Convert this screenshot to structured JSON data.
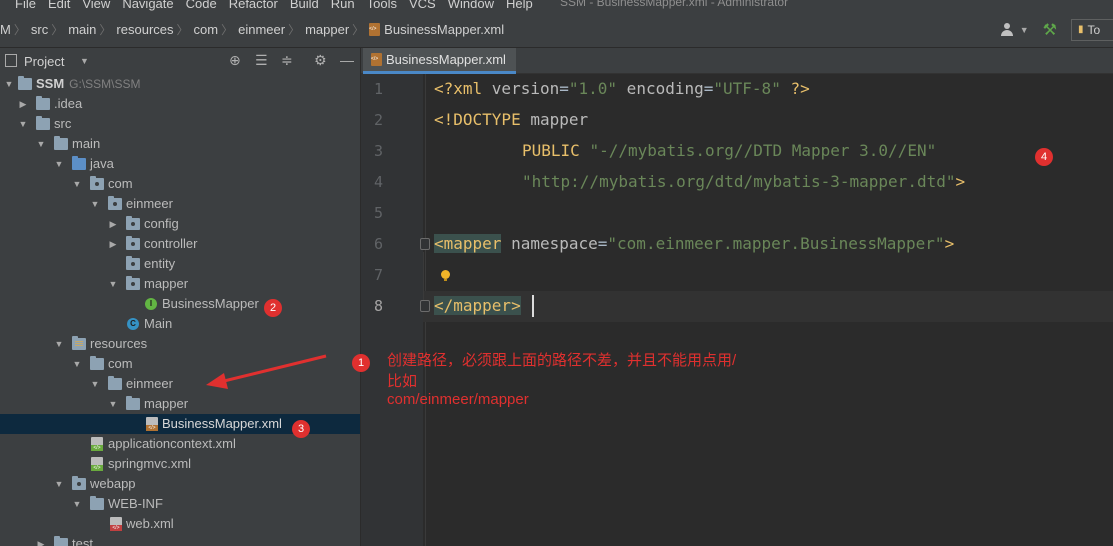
{
  "menu": [
    "File",
    "Edit",
    "View",
    "Navigate",
    "Code",
    "Refactor",
    "Build",
    "Run",
    "Tools",
    "VCS",
    "Window",
    "Help"
  ],
  "window_title": "SSM - BusinessMapper.xml - Administrator",
  "breadcrumbs": [
    "M",
    "src",
    "main",
    "resources",
    "com",
    "einmeer",
    "mapper",
    "BusinessMapper.xml"
  ],
  "run_config_label": "To",
  "project_panel": {
    "title": "Project",
    "tree": [
      {
        "label": "SSM",
        "path": "G:\\SSM\\SSM"
      },
      {
        "label": ".idea"
      },
      {
        "label": "src"
      },
      {
        "label": "main"
      },
      {
        "label": "java"
      },
      {
        "label": "com"
      },
      {
        "label": "einmeer"
      },
      {
        "label": "config"
      },
      {
        "label": "controller"
      },
      {
        "label": "entity"
      },
      {
        "label": "mapper"
      },
      {
        "label": "BusinessMapper"
      },
      {
        "label": "Main"
      },
      {
        "label": "resources"
      },
      {
        "label": "com"
      },
      {
        "label": "einmeer"
      },
      {
        "label": "mapper"
      },
      {
        "label": "BusinessMapper.xml"
      },
      {
        "label": "applicationcontext.xml"
      },
      {
        "label": "springmvc.xml"
      },
      {
        "label": "webapp"
      },
      {
        "label": "WEB-INF"
      },
      {
        "label": "web.xml"
      },
      {
        "label": "test"
      }
    ]
  },
  "editor": {
    "tab_label": "BusinessMapper.xml",
    "line_numbers": [
      "1",
      "2",
      "3",
      "4",
      "5",
      "6",
      "7",
      "8"
    ],
    "code": {
      "l1_a": "<?xml ",
      "l1_b": "version",
      "l1_c": "=",
      "l1_d": "\"1.0\"",
      "l1_e": " encoding",
      "l1_f": "=",
      "l1_g": "\"UTF-8\"",
      "l1_h": " ?>",
      "l2_a": "<!DOCTYPE ",
      "l2_b": "mapper",
      "l3_a": "PUBLIC ",
      "l3_b": "\"-//mybatis.org//DTD Mapper 3.0//EN\"",
      "l4_a": "\"http://mybatis.org/dtd/mybatis-3-mapper.dtd\"",
      "l4_b": ">",
      "l6_a": "<mapper",
      "l6_b": " namespace",
      "l6_c": "=",
      "l6_d": "\"com.einmeer.mapper.BusinessMapper\"",
      "l6_e": ">",
      "l8_a": "</mapper>"
    }
  },
  "annotation": {
    "line1": "创建路径，必须跟上面的路径不差，并且不能用点用/",
    "line2": "比如",
    "line3": "com/einmeer/mapper"
  },
  "badges": [
    "1",
    "2",
    "3",
    "4"
  ],
  "colors": {
    "annotation_red": "#e0302f",
    "selection": "#0d293e",
    "tag": "#e8bf6a",
    "string": "#6a8759"
  }
}
